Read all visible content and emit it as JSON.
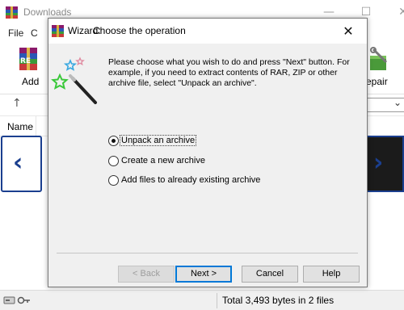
{
  "main_window": {
    "title": "Downloads",
    "controls": {
      "minimize": "—",
      "maximize": "☐",
      "close": "✕"
    },
    "menu": [
      "File",
      "C"
    ],
    "toolbar": {
      "add_label": "Add",
      "repair_label": "epair"
    },
    "address": {
      "up_glyph": "↑",
      "dropdown_glyph": "⌄"
    },
    "list": {
      "column_name": "Name"
    },
    "nav": {
      "prev_glyph": "‹",
      "next_glyph": "›"
    },
    "status": {
      "text": "Total 3,493 bytes in 2 files"
    }
  },
  "dialog": {
    "title_prefix": "Wizard:",
    "title": "Choose the operation",
    "close_glyph": "✕",
    "instructions": "Please choose what you wish to do and press \"Next\" button. For example, if you need to extract contents of RAR, ZIP or other archive file, select \"Unpack an archive\".",
    "options": [
      {
        "label": "Unpack an archive",
        "selected": true
      },
      {
        "label": "Create a new archive",
        "selected": false
      },
      {
        "label": "Add files to already existing archive",
        "selected": false
      }
    ],
    "buttons": {
      "back": "< Back",
      "next": "Next >",
      "cancel": "Cancel",
      "help": "Help"
    }
  },
  "colors": {
    "nav_border": "#1b3f8f",
    "default_button_border": "#0078d7",
    "dialog_background": "#f0f0f0"
  }
}
